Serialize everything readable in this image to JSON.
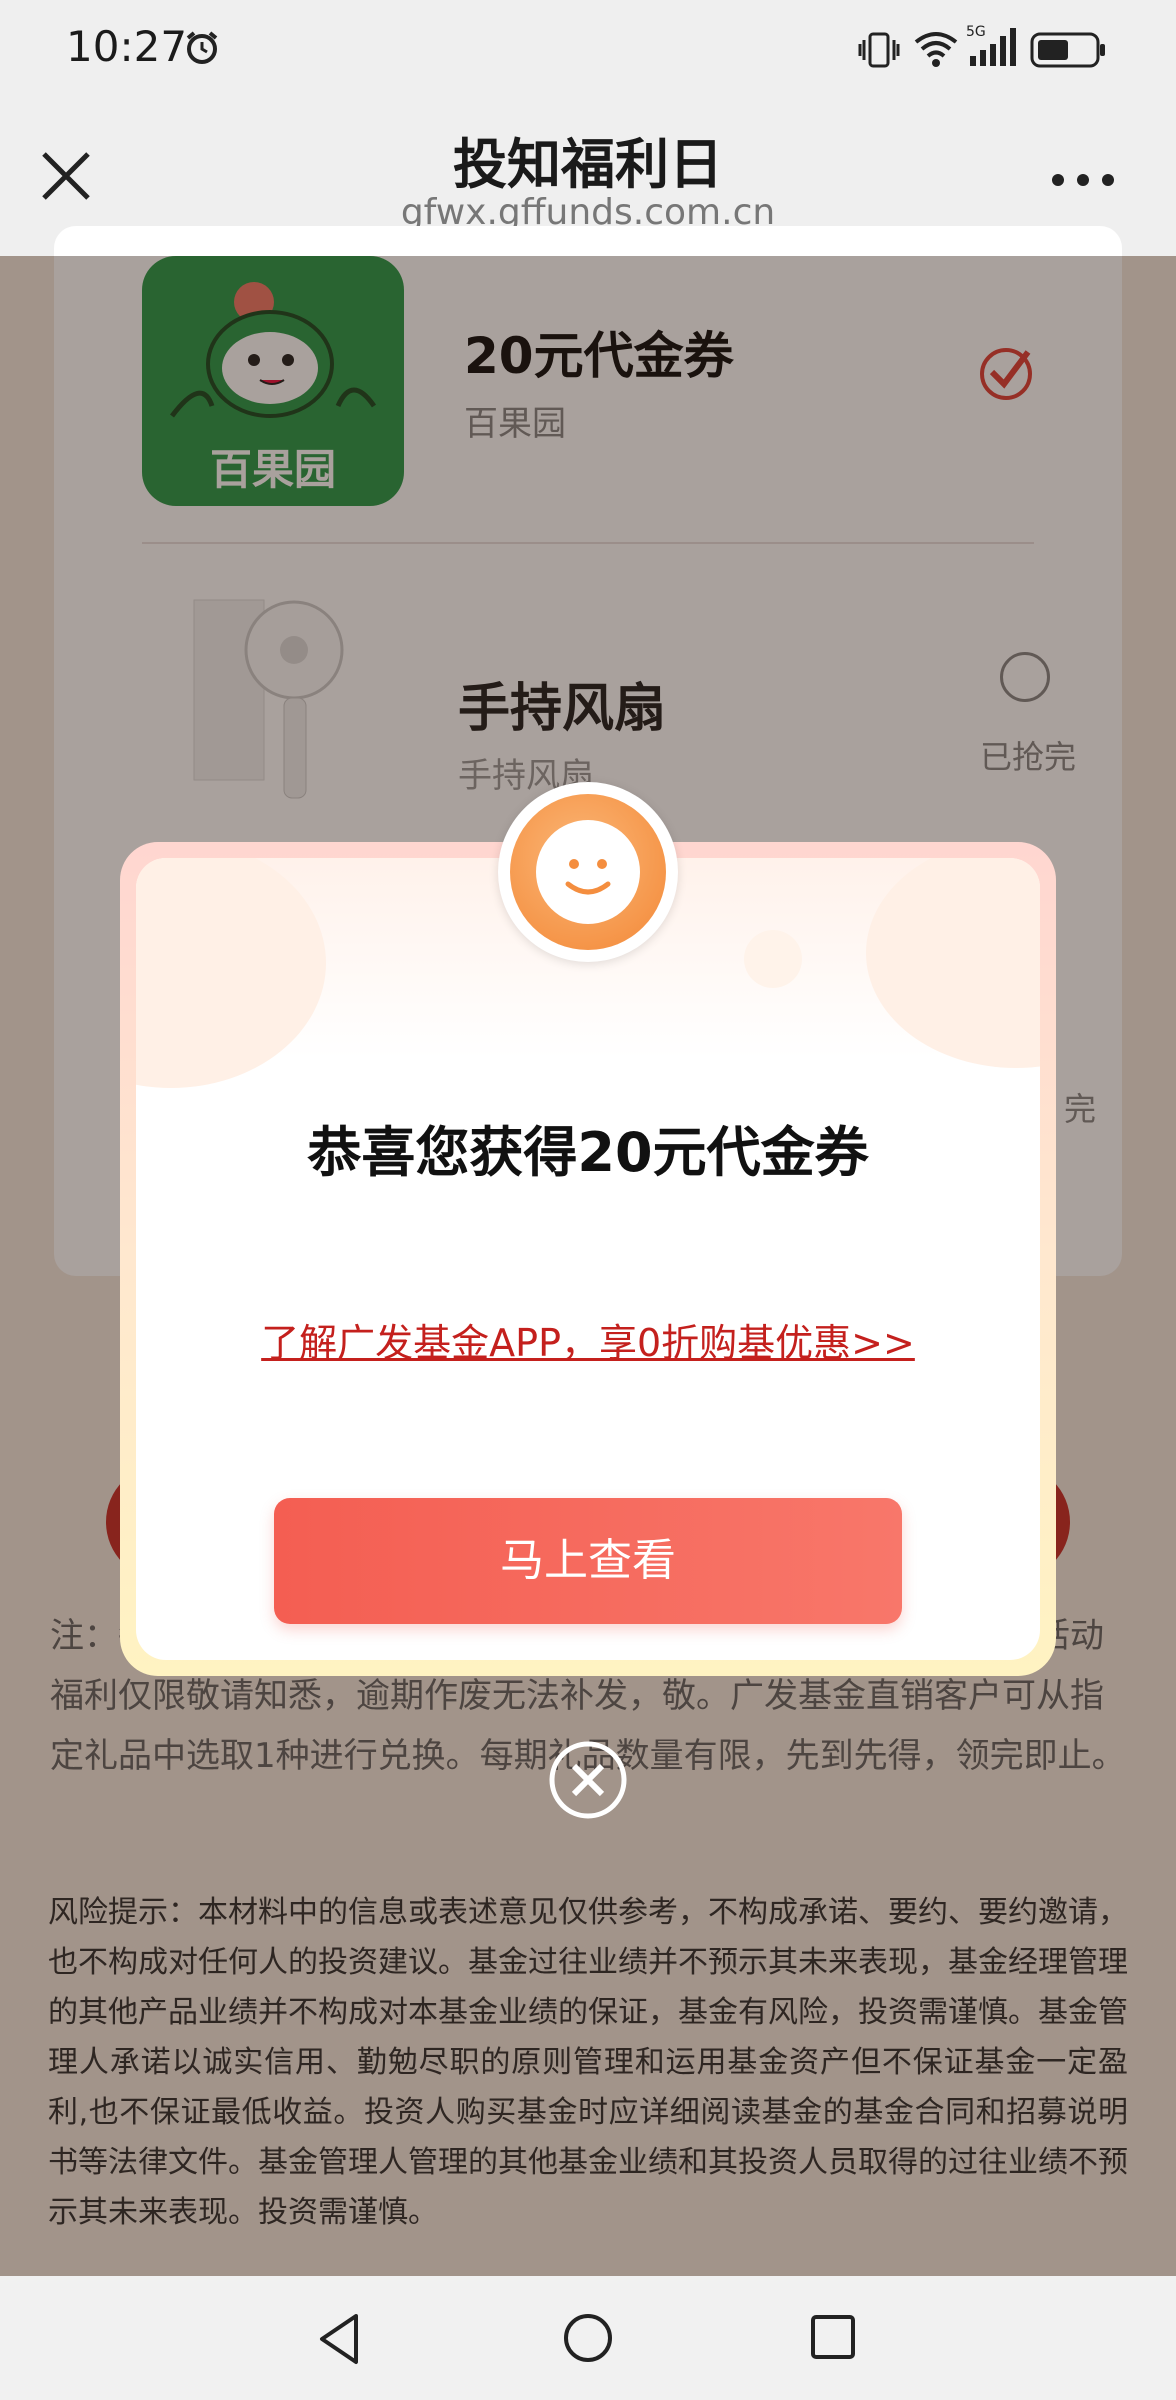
{
  "status_bar": {
    "time": "10:27"
  },
  "header": {
    "title": "投知福利日",
    "url": "gfwx.gffunds.com.cn"
  },
  "gifts": [
    {
      "title": "20元代金券",
      "subtitle": "百果园",
      "logo_text": "百果园",
      "selected": true
    },
    {
      "title": "手持风扇",
      "subtitle": "手持风扇",
      "status": "已抢完",
      "selected": false
    },
    {
      "status": "完"
    }
  ],
  "note": "注：每个参与用户仅限领取一次，礼品以实际发放为准。注意：本活动福利仅限敬请知悉，逾期作废无法补发，敬。广发基金直销客户可从指定礼品中选取1种进行兑换。每期礼品数量有限，先到先得，领完即止。",
  "risk_notice": "风险提示：本材料中的信息或表述意见仅供参考，不构成承诺、要约、要约邀请，也不构成对任何人的投资建议。基金过往业绩并不预示其未来表现，基金经理管理的其他产品业绩并不构成对本基金业绩的保证，基金有风险，投资需谨慎。基金管理人承诺以诚实信用、勤勉尽职的原则管理和运用基金资产但不保证基金一定盈利,也不保证最低收益。投资人购买基金时应详细阅读基金的基金合同和招募说明书等法律文件。基金管理人管理的其他基金业绩和其投资人员取得的过往业绩不预示其未来表现。投资需谨慎。",
  "modal": {
    "title": "恭喜您获得20元代金券",
    "promo_link": "了解广发基金APP，享0折购基优惠>>",
    "button_label": "马上查看"
  },
  "colors": {
    "accent_red": "#f45e52",
    "link_red": "#c4201d",
    "smile_orange": "#f8a25c",
    "logo_green": "#2b9a4c"
  }
}
